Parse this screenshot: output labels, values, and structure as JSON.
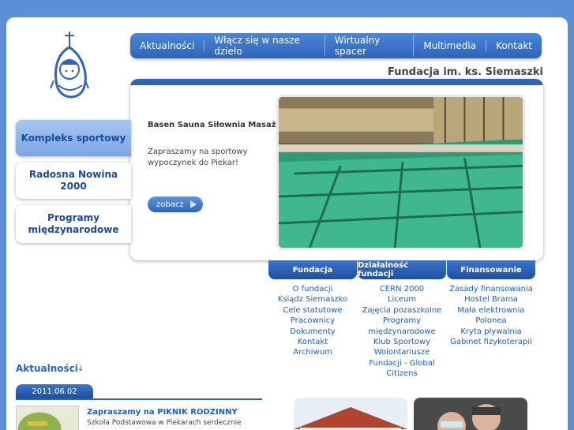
{
  "nav": {
    "items": [
      "Aktualności",
      "Włącz się w nasze dzieło",
      "Wirtualny spacer",
      "Multimedia",
      "Kontakt"
    ]
  },
  "header": {
    "foundation_title": "Fundacja im. ks. Siemaszki"
  },
  "side_tabs": [
    "Kompleks sportowy",
    "Radosna Nowina 2000",
    "Programy międzynarodowe"
  ],
  "feature": {
    "heading": "Basen Sauna Siłownia Masaż",
    "text": "Zapraszamy na sportowy wypoczynek do Piekar!",
    "button_label": "zobacz"
  },
  "columns": [
    {
      "title": "Fundacja",
      "links": [
        "O fundacji",
        "Ksiądz Siemaszko",
        "Cele statutowe",
        "Pracownicy",
        "Dokumenty",
        "Kontakt",
        "Archiwum"
      ]
    },
    {
      "title": "Działalność fundacji",
      "links": [
        "CERN 2000",
        "Liceum",
        "Zajęcia pozaszkolne",
        "Programy",
        "międzynarodowe",
        "Klub Sportowy",
        "Wolontariusze",
        "Fundacji - Global",
        "Citizens"
      ]
    },
    {
      "title": "Finansowanie",
      "links": [
        "Zasady finansowania",
        "Hostel Brama",
        "Mała elektrownia",
        "Polonea",
        "Kryta pływalnia",
        "Gabinet fizykoterapii"
      ]
    }
  ],
  "news": {
    "section_title": "Aktualności",
    "date": "2011.06.02",
    "item_title": "Zapraszamy na PIKNIK RODZINNY",
    "item_text": "Szkoła Podstawowa w Piekarach serdecznie"
  },
  "colors": {
    "accent": "#2f64b8",
    "background": "#5b8fd6",
    "link": "#1f5fb8"
  }
}
